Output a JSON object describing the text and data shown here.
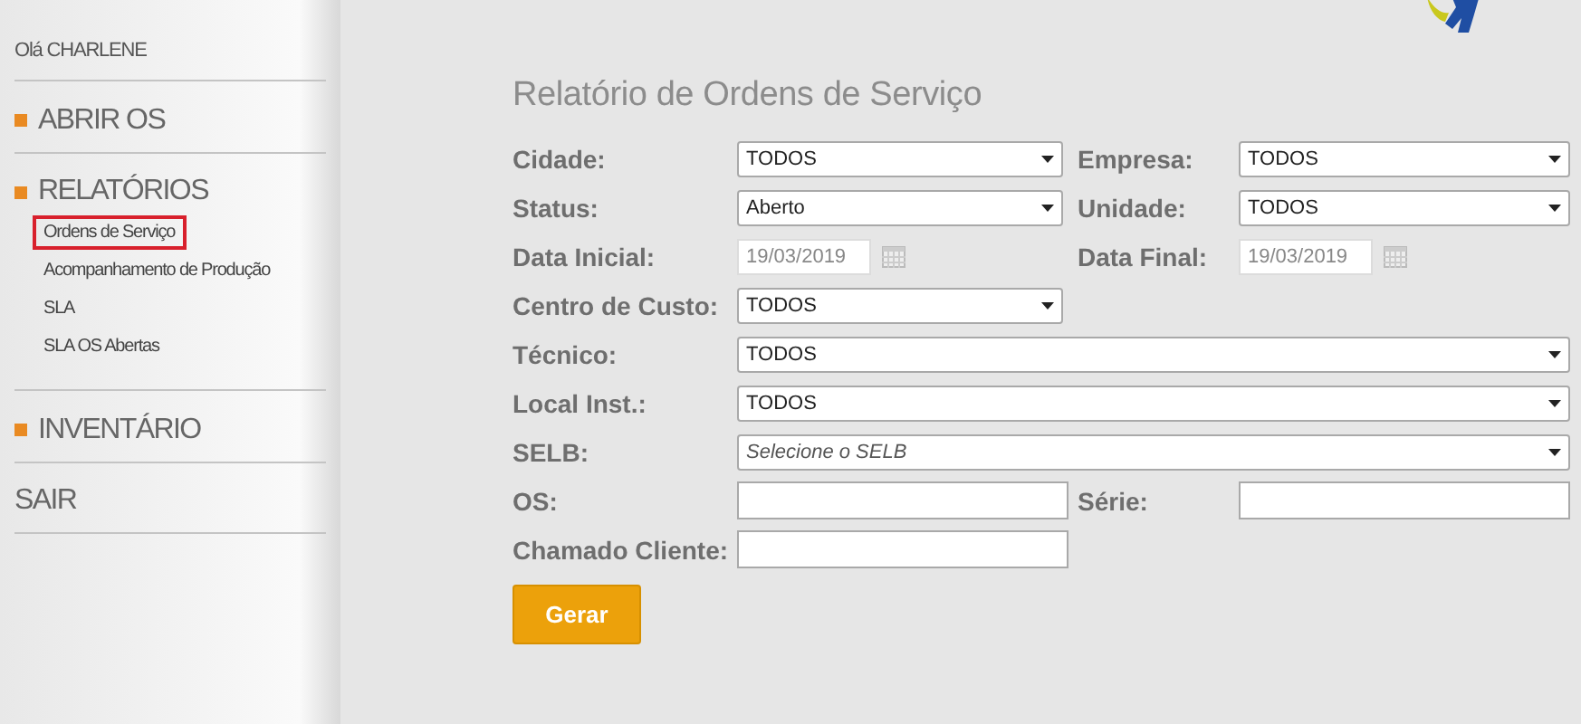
{
  "sidebar": {
    "greeting": "Olá CHARLENE",
    "menu": [
      {
        "label": "ABRIR OS",
        "kind": "section"
      },
      {
        "label": "RELATÓRIOS",
        "kind": "section",
        "children": [
          {
            "label": "Ordens de Serviço",
            "selected": true
          },
          {
            "label": "Acompanhamento de Produção",
            "selected": false
          },
          {
            "label": "SLA",
            "selected": false
          },
          {
            "label": "SLA OS Abertas",
            "selected": false
          }
        ]
      },
      {
        "label": "INVENTÁRIO",
        "kind": "section"
      },
      {
        "label": "SAIR",
        "kind": "link"
      }
    ]
  },
  "form": {
    "title": "Relatório de Ordens de Serviço",
    "rows": [
      [
        {
          "label": "Cidade:",
          "kind": "select",
          "value": "TODOS"
        },
        {
          "label": "Empresa:",
          "kind": "select",
          "value": "TODOS"
        }
      ],
      [
        {
          "label": "Status:",
          "kind": "select",
          "value": "Aberto"
        },
        {
          "label": "Unidade:",
          "kind": "select",
          "value": "TODOS"
        }
      ],
      [
        {
          "label": "Data Inicial:",
          "kind": "date",
          "value": "19/03/2019",
          "disabled": true
        },
        {
          "label": "Data Final:",
          "kind": "date",
          "value": "19/03/2019",
          "disabled": true
        }
      ],
      [
        {
          "label": "Centro de Custo:",
          "kind": "select",
          "value": "TODOS"
        }
      ],
      [
        {
          "label": "Técnico:",
          "kind": "wide_select",
          "value": "TODOS"
        }
      ],
      [
        {
          "label": "Local Inst.:",
          "kind": "wide_select",
          "value": "TODOS"
        }
      ],
      [
        {
          "label": "SELB:",
          "kind": "wide_select",
          "placeholder": "Selecione o SELB"
        }
      ],
      [
        {
          "label": "OS:",
          "kind": "text"
        },
        {
          "label": "Série:",
          "kind": "text"
        }
      ],
      [
        {
          "label": "Chamado Cliente:",
          "kind": "text"
        }
      ]
    ],
    "button": "Gerar"
  }
}
